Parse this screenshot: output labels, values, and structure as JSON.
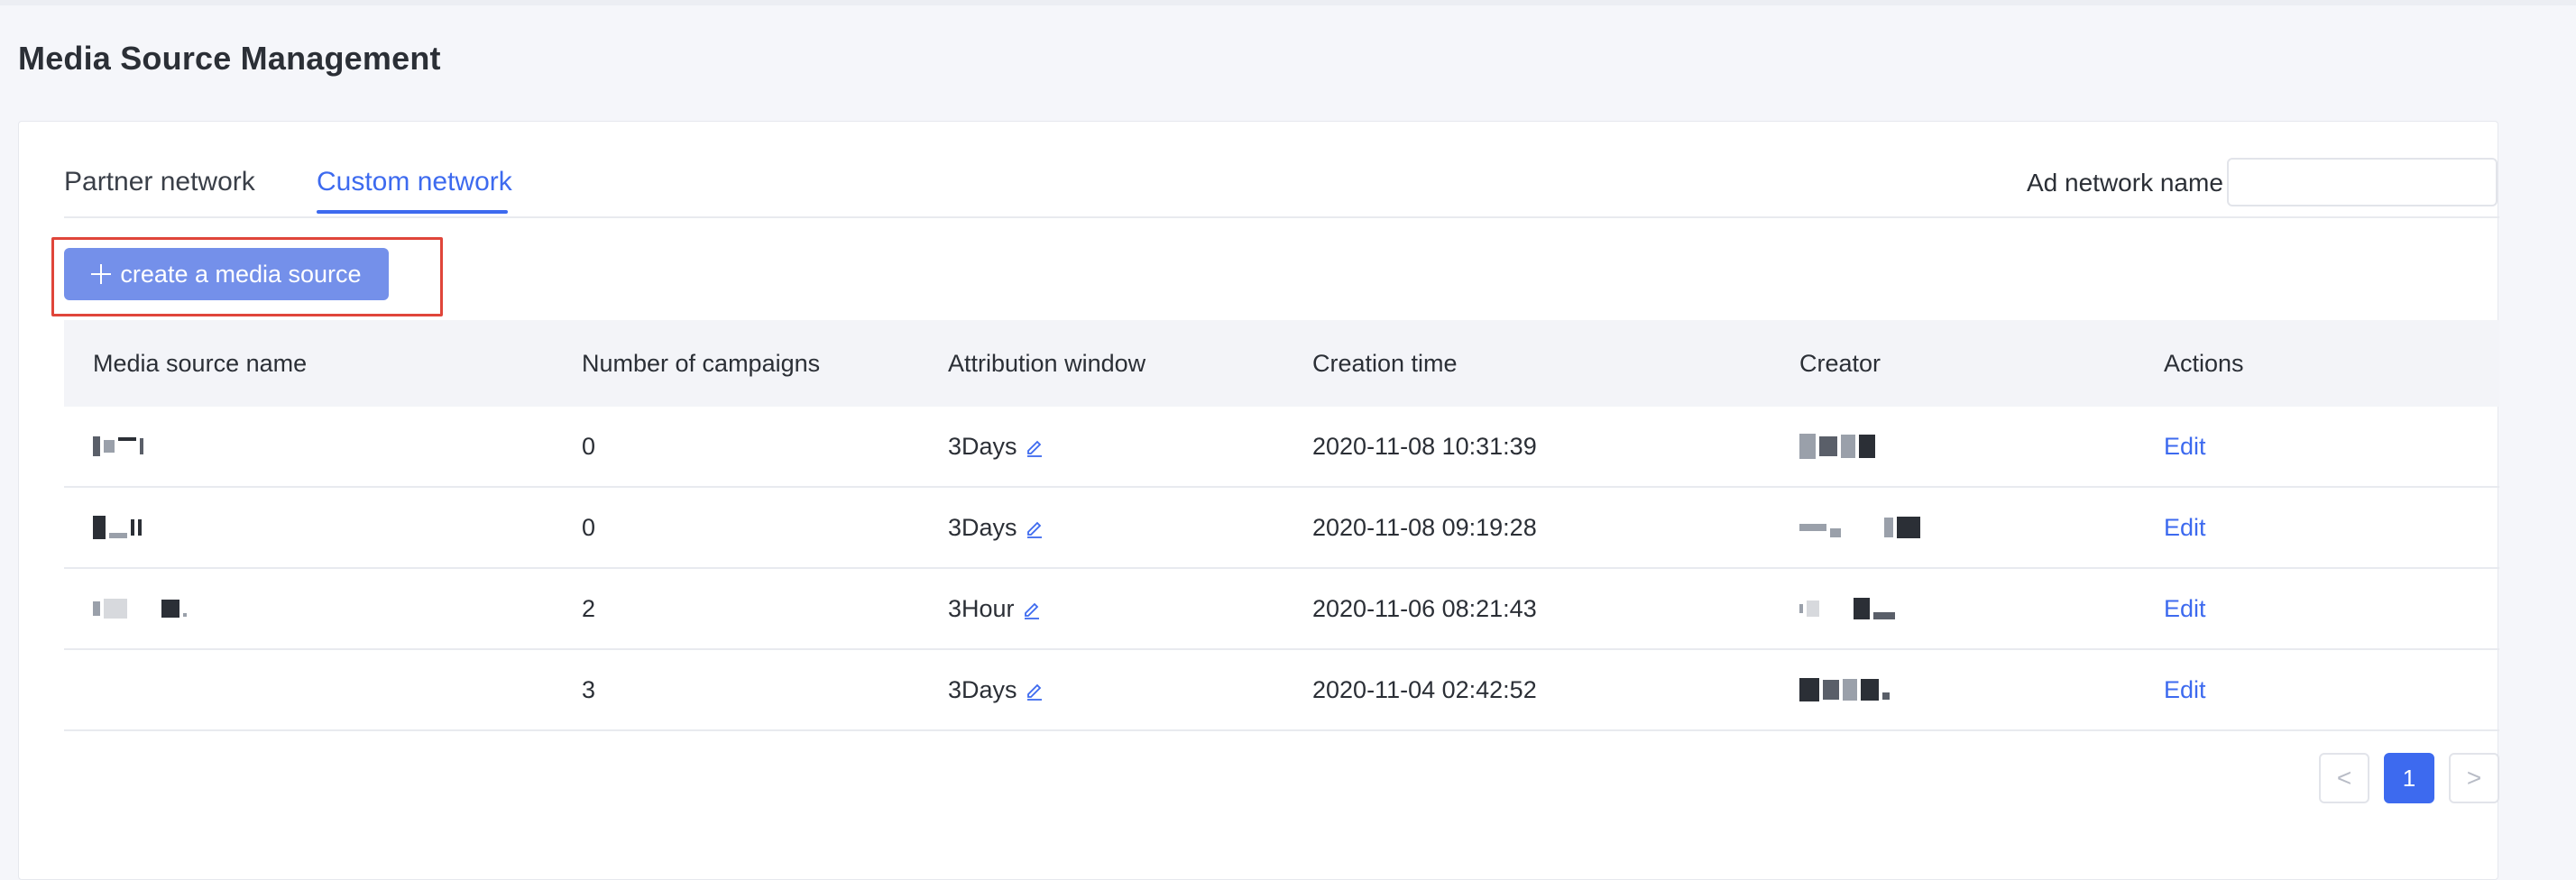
{
  "page": {
    "title": "Media Source Management"
  },
  "tabs": [
    {
      "label": "Partner network",
      "active": false
    },
    {
      "label": "Custom network",
      "active": true
    }
  ],
  "search": {
    "label": "Ad network name",
    "value": "",
    "placeholder": ""
  },
  "toolbar": {
    "create_label": "create a media source"
  },
  "table": {
    "headers": [
      "Media source name",
      "Number of campaigns",
      "Attribution window",
      "Creation time",
      "Creator",
      "Actions"
    ],
    "rows": [
      {
        "campaigns": "0",
        "window": "3Days",
        "created": "2020-11-08 10:31:39",
        "action": "Edit"
      },
      {
        "campaigns": "0",
        "window": "3Days",
        "created": "2020-11-08 09:19:28",
        "action": "Edit"
      },
      {
        "campaigns": "2",
        "window": "3Hour",
        "created": "2020-11-06 08:21:43",
        "action": "Edit"
      },
      {
        "campaigns": "3",
        "window": "3Days",
        "created": "2020-11-04 02:42:52",
        "action": "Edit"
      }
    ]
  },
  "pagination": {
    "current": "1",
    "prev": "<",
    "next": ">"
  },
  "colors": {
    "accent": "#3d6aef",
    "button": "#7490ea",
    "highlight": "#e0453a"
  }
}
